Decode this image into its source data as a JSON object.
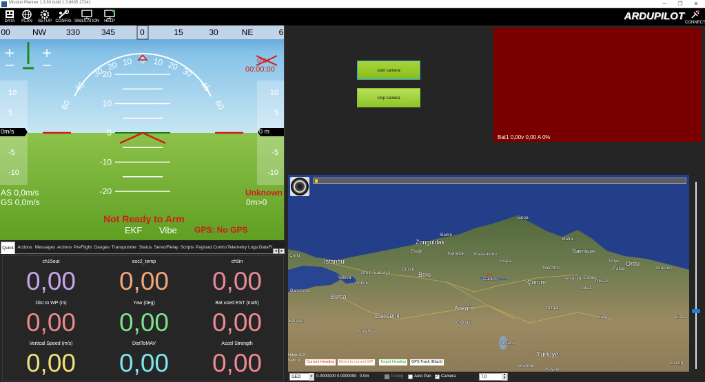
{
  "window": {
    "title": "Mission Planner 1.3.80 build 1.3.8635.17241",
    "controls": [
      "─",
      "❐",
      "✕"
    ]
  },
  "toolbar": {
    "buttons": [
      {
        "label": "DATA",
        "icon": "data-icon"
      },
      {
        "label": "PLAN",
        "icon": "globe-icon"
      },
      {
        "label": "SETUP",
        "icon": "setup-icon"
      },
      {
        "label": "CONFIG",
        "icon": "config-icon"
      },
      {
        "label": "SIMULATION",
        "icon": "monitor-icon"
      },
      {
        "label": "HELP",
        "icon": "help-icon"
      }
    ],
    "logo": "ARDUPILOT",
    "connect_label": "CONNECT"
  },
  "hud": {
    "heading_scale": [
      "00",
      "NW",
      "330",
      "345",
      "0",
      "15",
      "30",
      "NE",
      "6"
    ],
    "heading_current": "0",
    "roll_labels": [
      "60",
      "45",
      "30",
      "20",
      "10",
      "0",
      "10",
      "20",
      "30",
      "45",
      "60"
    ],
    "pitch_labels": [
      "20",
      "10",
      "0",
      "-10",
      "-20"
    ],
    "speed_tape": [
      "10",
      "5",
      "-5",
      "-10"
    ],
    "speed_current": "0m/s",
    "alt_tape": [
      "10",
      "5",
      "-5",
      "-10"
    ],
    "alt_current": "0 m",
    "battery_pct": "0%",
    "timer": "00:00:00",
    "airspeed": "AS 0,0m/s",
    "groundspeed": "GS 0,0m/s",
    "mode": "Unknown",
    "dist_home": "0m>0",
    "arm_status": "Not Ready to Arm",
    "ekf": "EKF",
    "vibe": "Vibe",
    "gps": "GPS: No GPS",
    "colors": {
      "sky": "#a8d6ec",
      "ground": "#7cb53a",
      "warning": "#d41a1a"
    }
  },
  "tabs": [
    "Quick",
    "Actions",
    "Messages",
    "Actions",
    "PreFlight",
    "Gauges",
    "Transponder",
    "Status",
    "Servo/Relay",
    "Scripts",
    "Payload Control",
    "Telemetry Logs",
    "DataFl"
  ],
  "tab_arrows": [
    "◂",
    "▸"
  ],
  "quick": [
    {
      "label": "ch15out",
      "value": "0,00",
      "color": "#c9a4e8"
    },
    {
      "label": "esc2_temp",
      "value": "0,00",
      "color": "#f0a878"
    },
    {
      "label": "ch5in",
      "value": "0,00",
      "color": "#e88a96"
    },
    {
      "label": "Dist to WP (m)",
      "value": "0,00",
      "color": "#ec8a8a"
    },
    {
      "label": "Yaw (deg)",
      "value": "0,00",
      "color": "#7ee08a"
    },
    {
      "label": "Bat used EST (mah)",
      "value": "0,00",
      "color": "#ee8a90"
    },
    {
      "label": "Vertical Speed (m/s)",
      "value": "0,00",
      "color": "#f0e07a"
    },
    {
      "label": "DistToMAV",
      "value": "0,00",
      "color": "#7ee6ec"
    },
    {
      "label": "Accel Strength",
      "value": "0,00",
      "color": "#ee8a90"
    }
  ],
  "camera": {
    "start_label": "start camera",
    "stop_label": "stop camera"
  },
  "battery_panel": {
    "text": "Bat1 0,00v 0,00 A 0%"
  },
  "map": {
    "places": [
      {
        "name": "Sinop",
        "size": ""
      },
      {
        "name": "Bartın",
        "size": ""
      },
      {
        "name": "Bafra",
        "size": ""
      },
      {
        "name": "Zonguldak",
        "size": ""
      },
      {
        "name": "Samsun",
        "size": ""
      },
      {
        "name": "Çorlu",
        "size": ""
      },
      {
        "name": "Ereğli",
        "size": ""
      },
      {
        "name": "Karabük",
        "size": ""
      },
      {
        "name": "Ünye",
        "size": ""
      },
      {
        "name": "İstanbul",
        "size": "big"
      },
      {
        "name": "Kastamonu",
        "size": ""
      },
      {
        "name": "Tosya",
        "size": ""
      },
      {
        "name": "Merzifon",
        "size": ""
      },
      {
        "name": "Ordu",
        "size": ""
      },
      {
        "name": "Giresun",
        "size": ""
      },
      {
        "name": "Düzce",
        "size": ""
      },
      {
        "name": "Yalova",
        "size": ""
      },
      {
        "name": "İzmit",
        "size": ""
      },
      {
        "name": "Sakarya",
        "size": ""
      },
      {
        "name": "Bolu",
        "size": ""
      },
      {
        "name": "Gölcük",
        "size": ""
      },
      {
        "name": "Çankırı",
        "size": ""
      },
      {
        "name": "Amasya",
        "size": ""
      },
      {
        "name": "Erbaa",
        "size": ""
      },
      {
        "name": "Niksar",
        "size": ""
      },
      {
        "name": "Fatsa",
        "size": ""
      },
      {
        "name": "Çorum",
        "size": ""
      },
      {
        "name": "Tokat",
        "size": ""
      },
      {
        "name": "Bandırma",
        "size": ""
      },
      {
        "name": "Bursa",
        "size": "big"
      },
      {
        "name": "Ankara",
        "size": "big"
      },
      {
        "name": "Yozgat",
        "size": ""
      },
      {
        "name": "Sivas",
        "size": ""
      },
      {
        "name": "Erzin",
        "size": ""
      },
      {
        "name": "Balıkesir",
        "size": ""
      },
      {
        "name": "Eskişehir",
        "size": "big"
      },
      {
        "name": "Gölbaşı",
        "size": ""
      },
      {
        "name": "Kütahya",
        "size": ""
      },
      {
        "name": "Kırşehir",
        "size": ""
      },
      {
        "name": "Türkiye",
        "size": "xl"
      },
      {
        "name": "Nevşehir",
        "size": ""
      },
      {
        "name": "Kayseri",
        "size": ""
      },
      {
        "name": "Elazığ",
        "size": ""
      }
    ],
    "info": "Hdop: 0,0\nSats: 0",
    "legend": [
      {
        "label": "Current Heading",
        "color": "#e02020"
      },
      {
        "label": "Direct to current WP",
        "color": "#e07020"
      },
      {
        "label": "Target Heading",
        "color": "#22aa22"
      },
      {
        "label": "GPS Track (Black)",
        "color": "#000000"
      }
    ]
  },
  "bottombar": {
    "coord_system": "GEO",
    "coordinates": "0.0000000 0.0000000",
    "altitude": "0.0m",
    "tuning_label": "Tuning",
    "autopan_label": "Auto Pan",
    "camera_label": "Camera",
    "camera_checked": true,
    "zoom": "7,0"
  }
}
